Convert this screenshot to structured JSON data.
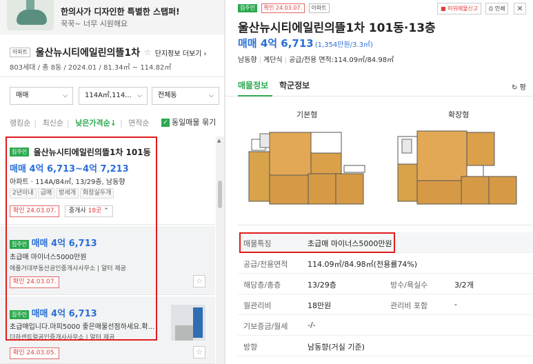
{
  "ad": {
    "title": "한의사가 디자인한 특별한 스탭퍼!",
    "subtitle": "꾹꾹~ 너무 시원해요"
  },
  "complex": {
    "type_tag": "아파트",
    "name": "울산뉴시티에일린의뜰1차",
    "info_link": "단지정보 더보기",
    "meta": "803세대 / 총 8동 / 2024.01 / 81.34㎡ ~ 114.82㎡"
  },
  "filters": {
    "trade": "매매",
    "area": "114A㎡,114...",
    "building": "전체동"
  },
  "sort": {
    "options": [
      "랭킹순",
      "최신순",
      "낮은가격순↓",
      "면적순"
    ],
    "duplicate_label": "동일매물 묶기"
  },
  "listings": [
    {
      "badge": "집주인",
      "title": "울산뉴시티에일린의뜰1차 101동",
      "price_label": "매매 4억 6,713~4억 7,213",
      "details": "아파트 · 114A/84㎡, 13/29층, 남동향",
      "chips": [
        "2년이내",
        "급매",
        "방세개",
        "화장실두개"
      ],
      "confirm": "확인 24.03.07.",
      "agent_label": "중개사",
      "agent_count": "18곳"
    },
    {
      "badge": "집주인",
      "price_label": "매매 4억 6,713",
      "description": "초급매 마이너스5000만원",
      "agent": "에플거대부동산공인중개사사무소",
      "provider": "알터 제공",
      "confirm": "확인 24.03.07."
    },
    {
      "badge": "집주인",
      "price_label": "매매 4억 6,713",
      "description": "초급매입니다.마피5000 좋은매물선점하세요.확...",
      "agent": "더하센트럴공인중개사사무소",
      "provider": "알터 제공",
      "confirm": "확인 24.03.05."
    }
  ],
  "detail": {
    "badge": "집주인",
    "confirm": "확인 24.03.07.",
    "type_tag": "아파트",
    "report_btn": "허위매물신고",
    "print_btn": "인쇄",
    "title": "울산뉴시티에일린의뜰1차 101동·13층",
    "price": "매매 4억 6,713",
    "price_per": "(1,354만원/3.3㎡)",
    "meta": [
      "남동향",
      "계단식",
      "공급/전용 면적:114.09㎡/84.98㎡"
    ],
    "tabs": [
      "매물정보",
      "학군정보"
    ],
    "refresh": "평",
    "plan_labels": [
      "기본형",
      "확장형"
    ],
    "rows": [
      {
        "k": "매물특징",
        "v": "초급매 마이너스5000만원"
      },
      {
        "k": "공급/전용면적",
        "v": "114.09㎡/84.98㎡(전용률74%)"
      },
      {
        "k": "해당층/총층",
        "v": "13/29층",
        "k2": "방수/욕실수",
        "v2": "3/2개"
      },
      {
        "k": "월관리비",
        "v": "18만원",
        "k2": "관리비 포함",
        "v2": "-"
      },
      {
        "k": "기보증금/월세",
        "v": "-/-"
      },
      {
        "k": "방향",
        "v": "남동향(거실 기준)"
      }
    ]
  },
  "colors": {
    "accent_green": "#2ca94f",
    "price_blue": "#2b6fd6",
    "highlight_red": "#e11b1b"
  }
}
